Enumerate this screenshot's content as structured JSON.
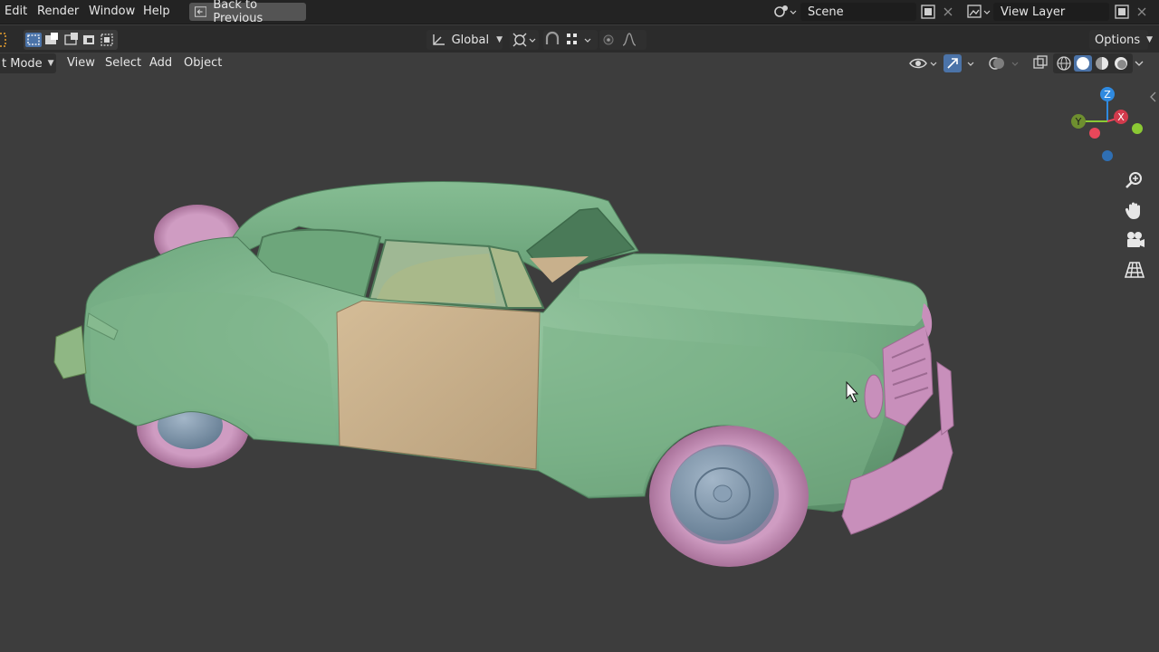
{
  "topbar": {
    "menu": [
      "Edit",
      "Render",
      "Window",
      "Help"
    ],
    "back_button": "Back to Previous",
    "scene": {
      "label": "Scene"
    },
    "view_layer": {
      "label": "View Layer"
    }
  },
  "toolbar": {
    "transform_orientation": "Global",
    "options_label": "Options"
  },
  "header": {
    "mode": "t Mode",
    "menu": [
      "View",
      "Select",
      "Add",
      "Object"
    ]
  },
  "gizmo": {
    "z": "Z",
    "y": "Y",
    "x": "X",
    "colors": {
      "x": "#e8475a",
      "y": "#8bc934",
      "z": "#2f8ae0"
    }
  },
  "icons": [
    "back-icon",
    "scene-icon",
    "copy-icon",
    "close-icon",
    "view-layer-icon",
    "zoom-icon",
    "hand-icon",
    "camera-icon",
    "grid-icon"
  ],
  "colors": {
    "body": "#7ab489",
    "door": "#c9b08c",
    "tire": "#c58fb6",
    "hub": "#7f96ab",
    "background": "#3d3d3d"
  }
}
